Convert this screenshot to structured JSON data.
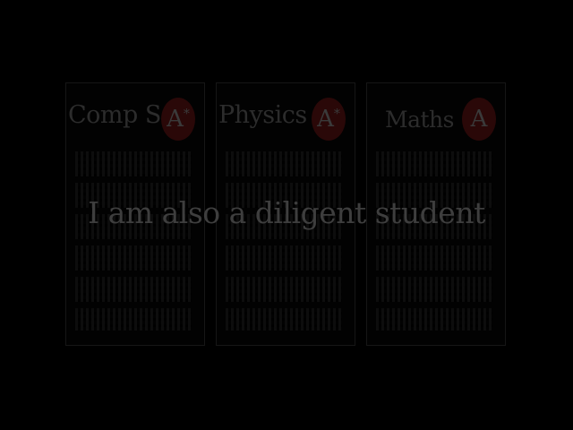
{
  "cards": [
    {
      "subject": "Comp Sci",
      "grade": "A",
      "grade_suffix": "*"
    },
    {
      "subject": "Physics",
      "grade": "A",
      "grade_suffix": "*"
    },
    {
      "subject": "Maths",
      "grade": "A",
      "grade_suffix": ""
    }
  ],
  "caption": "I am also a diligent student",
  "colors": {
    "background": "#000000",
    "grade_badge": "#2a0808",
    "text": "#3e3e3e"
  }
}
